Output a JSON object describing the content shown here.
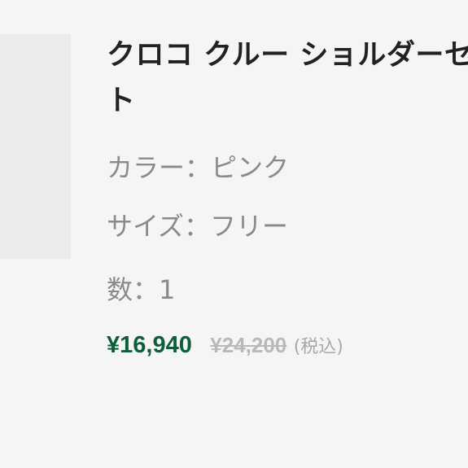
{
  "product": {
    "title": "クロコ クルー ショルダーセット",
    "color_line": "カラー：ピンク",
    "size_line": "サイズ：フリー",
    "quantity_line": "数：1",
    "sale_price": "¥16,940",
    "original_price": "¥24,200",
    "tax_label": "(税込)"
  },
  "colors": {
    "background": "#f5f5f5",
    "thumbnail": "#ebebeb",
    "title": "#222222",
    "spec_text": "#8a8a8a",
    "sale_price": "#0f5e3a",
    "original_price": "#b9b9b9"
  }
}
